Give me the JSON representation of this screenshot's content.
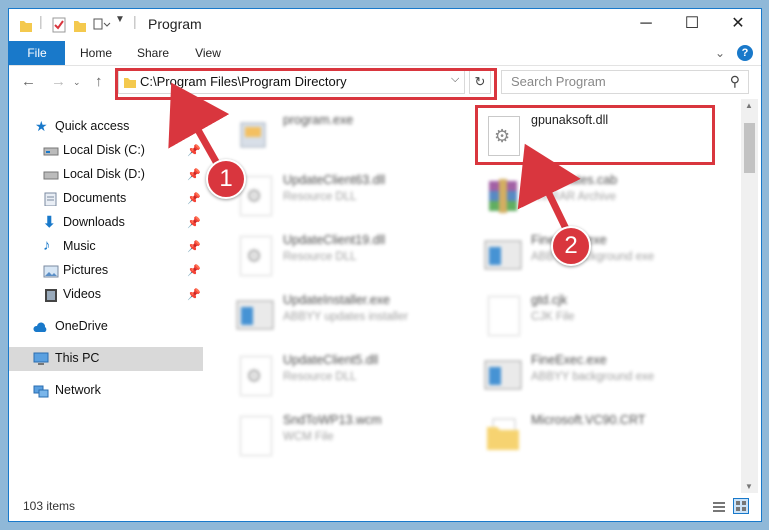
{
  "window": {
    "title": "Program"
  },
  "ribbon": {
    "tabs": [
      "File",
      "Home",
      "Share",
      "View"
    ]
  },
  "address": {
    "path": "C:\\Program Files\\Program Directory"
  },
  "search": {
    "placeholder": "Search Program"
  },
  "navigation": {
    "items": [
      {
        "label": "Quick access",
        "icon": "star-icon"
      },
      {
        "label": "Local Disk (C:)",
        "icon": "drive-icon",
        "pinned": true
      },
      {
        "label": "Local Disk (D:)",
        "icon": "drive-icon",
        "pinned": true
      },
      {
        "label": "Documents",
        "icon": "documents-icon",
        "pinned": true
      },
      {
        "label": "Downloads",
        "icon": "downloads-icon",
        "pinned": true
      },
      {
        "label": "Music",
        "icon": "music-icon",
        "pinned": true
      },
      {
        "label": "Pictures",
        "icon": "pictures-icon",
        "pinned": true
      },
      {
        "label": "Videos",
        "icon": "videos-icon",
        "pinned": true
      },
      {
        "label": "OneDrive",
        "icon": "cloud-icon"
      },
      {
        "label": "This PC",
        "icon": "computer-icon",
        "selected": true
      },
      {
        "label": "Network",
        "icon": "network-icon"
      }
    ]
  },
  "files": [
    {
      "name": "program.exe",
      "type": "",
      "icon": "program-icon"
    },
    {
      "name": "gpunaksoft.dll",
      "type": "",
      "icon": "dll-gear-icon"
    },
    {
      "name": "UpdateClient63.dll",
      "type": "Resource DLL",
      "icon": "dll-gear-icon"
    },
    {
      "name": "Certificates.cab",
      "type": "WinRAR Archive",
      "icon": "winrar-icon"
    },
    {
      "name": "UpdateClient19.dll",
      "type": "Resource DLL",
      "icon": "dll-gear-icon"
    },
    {
      "name": "FineExec.exe",
      "type": "ABBYY background exe",
      "icon": "exe-window-icon"
    },
    {
      "name": "UpdateInstaller.exe",
      "type": "ABBYY updates installer",
      "icon": "exe-window-icon"
    },
    {
      "name": "gtd.cjk",
      "type": "CJK File",
      "icon": "blank-doc-icon"
    },
    {
      "name": "UpdateClient5.dll",
      "type": "Resource DLL",
      "icon": "dll-gear-icon"
    },
    {
      "name": "FineExec.exe",
      "type": "ABBYY background exe",
      "icon": "exe-window-icon"
    },
    {
      "name": "SndToWP13.wcm",
      "type": "WCM File",
      "icon": "blank-doc-icon"
    },
    {
      "name": "Microsoft.VC90.CRT",
      "type": "",
      "icon": "folder-icon"
    }
  ],
  "status": {
    "item_count": "103 items"
  },
  "callouts": [
    "1",
    "2"
  ],
  "colors": {
    "accent": "#1979ca",
    "annotation": "#d9363e",
    "selected": "#d9d9d9"
  }
}
